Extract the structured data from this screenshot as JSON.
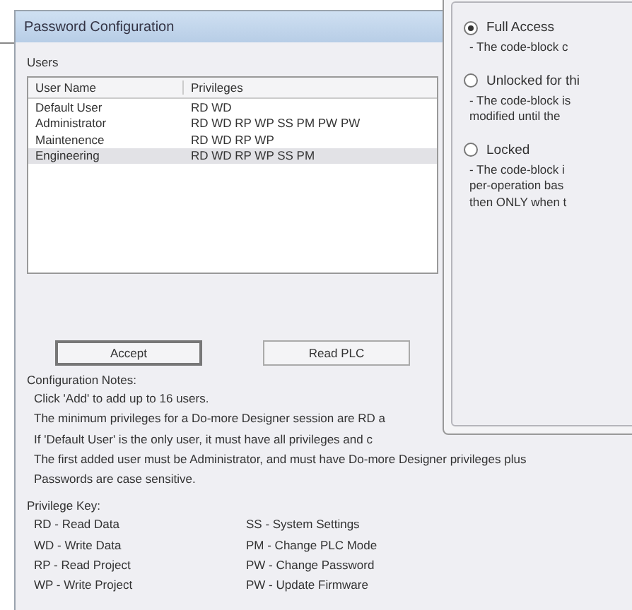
{
  "dialog": {
    "title": "Password Configuration",
    "users": {
      "label": "Users",
      "columns": [
        "User Name",
        "Privileges"
      ],
      "rows": [
        {
          "name": "Default User",
          "privileges": "RD WD",
          "selected": false
        },
        {
          "name": "Administrator",
          "privileges": "RD WD RP WP SS PM PW PW",
          "selected": false
        },
        {
          "name": "Maintenence",
          "privileges": "RD WD RP WP",
          "selected": false
        },
        {
          "name": "Engineering",
          "privileges": "RD WD RP WP SS PM",
          "selected": true
        }
      ]
    },
    "buttons": [
      {
        "label": "Accept",
        "default": true
      },
      {
        "label": "Read PLC",
        "default": false
      }
    ],
    "notes": {
      "heading": "Configuration Notes:",
      "lines": [
        "Click 'Add' to add up to 16 users.",
        "The minimum privileges for a Do-more Designer session are RD a",
        "If 'Default User' is the only user, it must have all privileges and c",
        "The first added user must be Administrator, and must have Do-more Designer privileges plus",
        "Passwords are case sensitive."
      ]
    },
    "key": {
      "heading": "Privilege Key:",
      "column_1": [
        "RD - Read Data",
        "WD - Write Data",
        "RP - Read Project",
        "WP - Write Project"
      ],
      "column_2": [
        "SS - System Settings",
        "PM - Change PLC Mode",
        "PW - Change Password",
        "PW - Update Firmware"
      ]
    }
  },
  "access_panel": {
    "options": [
      {
        "label": "Full Access",
        "selected": true,
        "description": [
          "- The code-block c"
        ]
      },
      {
        "label": "Unlocked for thi",
        "selected": false,
        "description": [
          "- The code-block is",
          "modified until the"
        ]
      },
      {
        "label": "Locked",
        "selected": false,
        "description": [
          "- The code-block i",
          "per-operation bas",
          "then ONLY when t"
        ]
      }
    ]
  }
}
